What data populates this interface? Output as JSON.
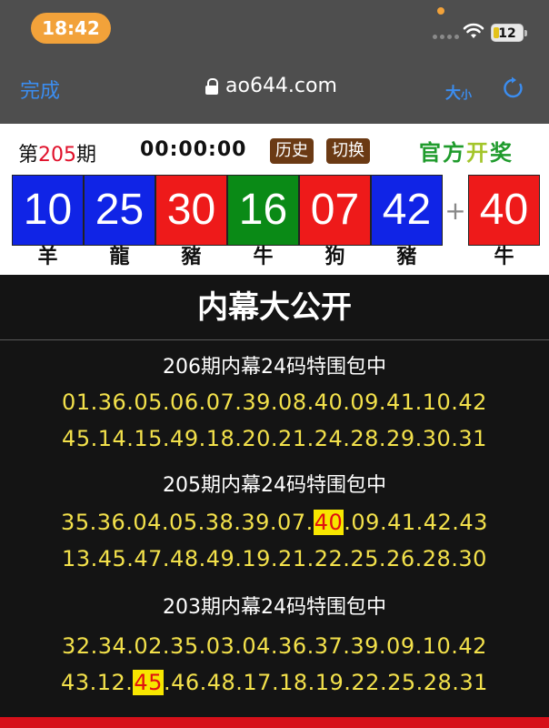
{
  "status_bar": {
    "time": "18:42",
    "battery": "12"
  },
  "nav": {
    "done": "完成",
    "url": "ao644.com",
    "size_big": "大",
    "size_small": "小"
  },
  "result": {
    "period_prefix": "第",
    "period_number": "205",
    "period_suffix": "期",
    "countdown": "00:00:00",
    "history_label": "历史",
    "switch_label": "切换",
    "official_a": "官方",
    "official_b": "开",
    "official_c": "奖",
    "balls": [
      {
        "number": "10",
        "zodiac": "羊",
        "color": "blue"
      },
      {
        "number": "25",
        "zodiac": "龍",
        "color": "blue"
      },
      {
        "number": "30",
        "zodiac": "豬",
        "color": "red"
      },
      {
        "number": "16",
        "zodiac": "牛",
        "color": "green"
      },
      {
        "number": "07",
        "zodiac": "狗",
        "color": "red"
      },
      {
        "number": "42",
        "zodiac": "豬",
        "color": "blue"
      }
    ],
    "plus": "+",
    "special": {
      "number": "40",
      "zodiac": "牛",
      "color": "red"
    }
  },
  "section": {
    "title": "内幕大公开",
    "blocks": [
      {
        "title": "206期内幕24码特围包中",
        "line1": "01.36.05.06.07.39.08.40.09.41.10.42",
        "line2": "45.14.15.49.18.20.21.24.28.29.30.31"
      },
      {
        "title": "205期内幕24码特围包中",
        "line1_before": "35.36.04.05.38.39.07.",
        "line1_hit": "40",
        "line1_after": ".09.41.42.43",
        "line2": "13.45.47.48.49.19.21.22.25.26.28.30"
      },
      {
        "title": "203期内幕24码特围包中",
        "line1": "32.34.02.35.03.04.36.37.39.09.10.42",
        "line2_before": "43.12.",
        "line2_hit": "45",
        "line2_after": ".46.48.17.18.19.22.25.28.31"
      }
    ]
  },
  "colors": {
    "red": "#ee1a1a",
    "blue": "#1024e6",
    "green": "#0a8a16",
    "highlight": "#f7e600",
    "number_text": "#f3e14b"
  }
}
